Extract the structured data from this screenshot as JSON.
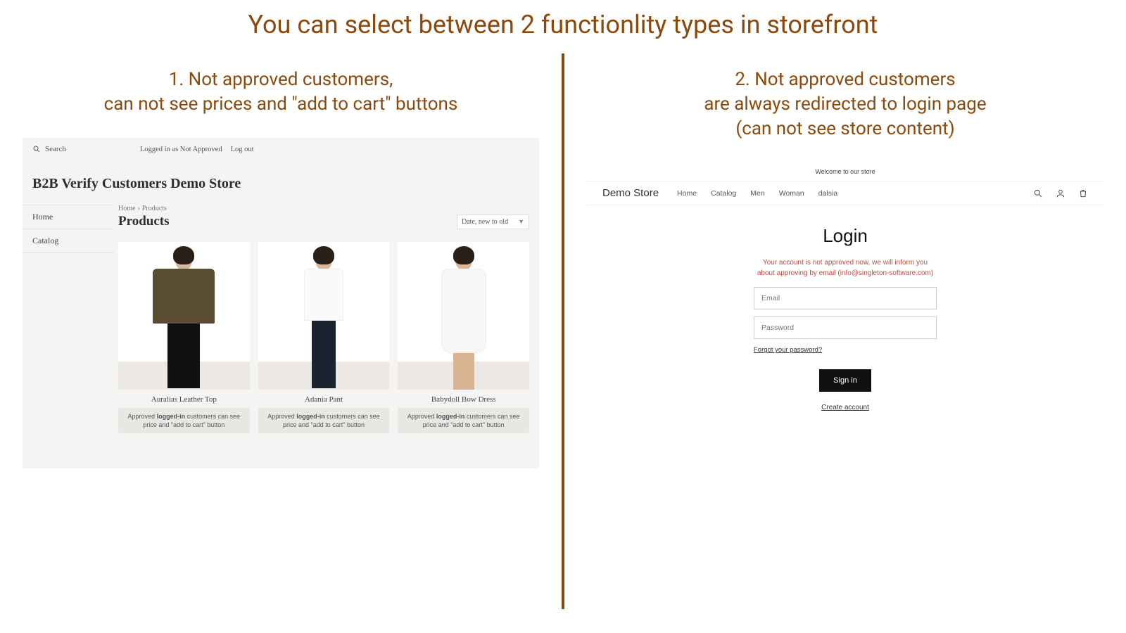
{
  "title": "You can select between 2 functionlity types in storefront",
  "left": {
    "subtitle_line1": "1. Not approved customers,",
    "subtitle_line2": "can not see prices and \"add to cart\" buttons",
    "store": {
      "search_label": "Search",
      "logged_in_as": "Logged in as Not Approved",
      "logout": "Log out",
      "title": "B2B Verify Customers Demo Store",
      "nav": {
        "home": "Home",
        "catalog": "Catalog"
      },
      "crumb_home": "Home",
      "crumb_products": "Products",
      "heading": "Products",
      "sort_label": "Date, new to old",
      "products": [
        {
          "name": "Auralias Leather Top"
        },
        {
          "name": "Adania Pant"
        },
        {
          "name": "Babydoll Bow Dress"
        }
      ],
      "approved_msg_prefix": "Approved ",
      "approved_msg_bold": "logged-in",
      "approved_msg_suffix": " customers can see price and \"add to cart\" button"
    }
  },
  "right": {
    "subtitle_line1": "2. Not approved customers",
    "subtitle_line2": "are always redirected to login page",
    "subtitle_line3": "(can not see store content)",
    "store": {
      "announce": "Welcome to our store",
      "brand": "Demo Store",
      "nav": {
        "home": "Home",
        "catalog": "Catalog",
        "men": "Men",
        "woman": "Woman",
        "dalsia": "dalsia"
      },
      "login_title": "Login",
      "warn_msg": "Your account is not approved now, we will inform you about approving by email (info@singleton-software.com)",
      "email_placeholder": "Email",
      "password_placeholder": "Password",
      "forgot": "Forgot your password?",
      "signin": "Sign in",
      "create": "Create account"
    }
  }
}
